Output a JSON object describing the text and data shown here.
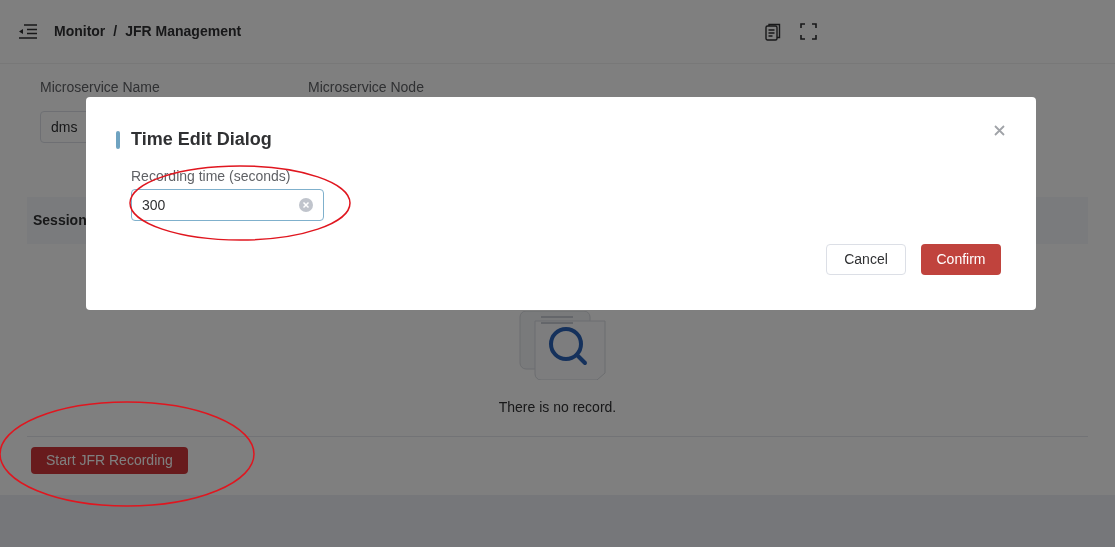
{
  "header": {
    "breadcrumb": [
      {
        "label": "Monitor"
      },
      {
        "label": "JFR Management"
      }
    ],
    "separator": "/"
  },
  "filters": [
    {
      "label": "Microservice Name",
      "value": "dms"
    },
    {
      "label": "Microservice Node"
    }
  ],
  "table": {
    "columns": [
      "Session"
    ]
  },
  "empty_state": {
    "message": "There is no record."
  },
  "actions": [
    {
      "label": "Start JFR Recording"
    }
  ],
  "dialog": {
    "title": "Time Edit Dialog",
    "field": {
      "label": "Recording time (seconds)",
      "value": "300"
    },
    "buttons": [
      {
        "label": "Cancel",
        "kind": "secondary"
      },
      {
        "label": "Confirm",
        "kind": "primary"
      }
    ]
  }
}
